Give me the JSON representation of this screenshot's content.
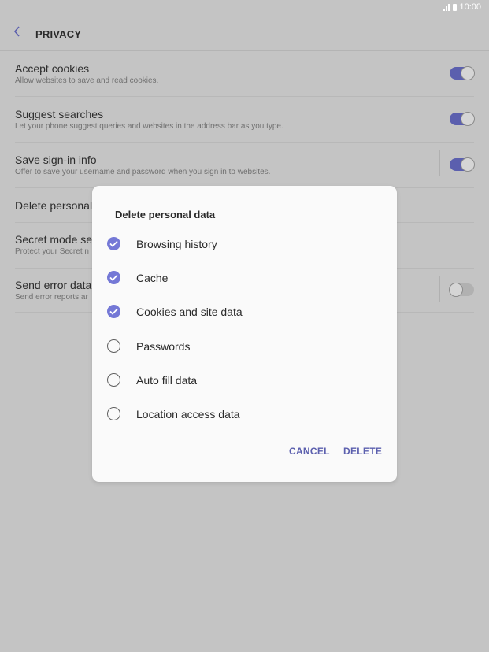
{
  "status_bar": {
    "time": "10:00",
    "icons": [
      "signal-icon",
      "battery-icon"
    ]
  },
  "header": {
    "title": "PRIVACY",
    "back_icon": "chevron-left-icon"
  },
  "settings": [
    {
      "title": "Accept cookies",
      "subtitle": "Allow websites to save and read cookies.",
      "toggle": true
    },
    {
      "title": "Suggest searches",
      "subtitle": "Let your phone suggest queries and websites in the address bar as you type.",
      "toggle": true
    },
    {
      "title": "Save sign-in info",
      "subtitle": "Offer to save your username and password when you sign in to websites.",
      "toggle": true
    },
    {
      "title": "Delete personal"
    },
    {
      "title": "Secret mode se",
      "subtitle": "Protect your Secret n"
    },
    {
      "title": "Send error data",
      "subtitle": "Send error reports ar",
      "toggle": false
    }
  ],
  "dialog": {
    "title": "Delete personal data",
    "options": [
      {
        "label": "Browsing history",
        "checked": true
      },
      {
        "label": "Cache",
        "checked": true
      },
      {
        "label": "Cookies and site data",
        "checked": true
      },
      {
        "label": "Passwords",
        "checked": false
      },
      {
        "label": "Auto fill data",
        "checked": false
      },
      {
        "label": "Location access data",
        "checked": false
      }
    ],
    "cancel_label": "CANCEL",
    "delete_label": "DELETE"
  },
  "colors": {
    "accent": "#5b5fae",
    "check_fill": "#7478d6",
    "scrim": "#c4c4c4"
  }
}
